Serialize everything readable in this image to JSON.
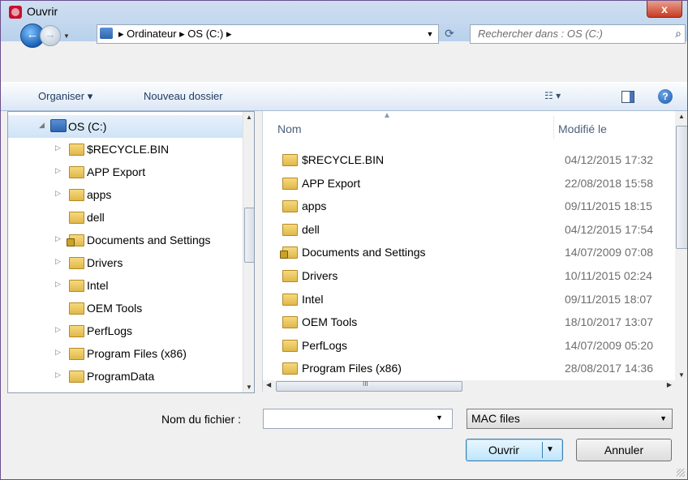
{
  "window": {
    "title": "Ouvrir",
    "close": "x"
  },
  "nav": {
    "back": "←",
    "forward": "→",
    "dropdown": "▼",
    "breadcrumb": "▸ Ordinateur ▸ OS (C:) ▸",
    "address_dropdown": "▼",
    "refresh": "⟳",
    "search_placeholder": "Rechercher dans : OS (C:)",
    "search_icon": "⌕"
  },
  "toolbar": {
    "organise": "Organiser ▾",
    "new_folder": "Nouveau dossier",
    "view_menu": "☷ ▾",
    "help": "?"
  },
  "tree": {
    "root": "OS (C:)",
    "items": [
      {
        "label": "$RECYCLE.BIN",
        "arrow": "▷"
      },
      {
        "label": "APP Export",
        "arrow": "▷"
      },
      {
        "label": "apps",
        "arrow": "▷"
      },
      {
        "label": "dell",
        "arrow": ""
      },
      {
        "label": "Documents and Settings",
        "arrow": "▷"
      },
      {
        "label": "Drivers",
        "arrow": "▷"
      },
      {
        "label": "Intel",
        "arrow": "▷"
      },
      {
        "label": "OEM Tools",
        "arrow": ""
      },
      {
        "label": "PerfLogs",
        "arrow": "▷"
      },
      {
        "label": "Program Files (x86)",
        "arrow": "▷"
      },
      {
        "label": "ProgramData",
        "arrow": "▷"
      }
    ],
    "root_arrow": "◢"
  },
  "files": {
    "col_name": "Nom",
    "col_modified": "Modifié le",
    "rows": [
      {
        "name": "$RECYCLE.BIN",
        "date": "04/12/2015 17:32"
      },
      {
        "name": "APP Export",
        "date": "22/08/2018 15:58"
      },
      {
        "name": "apps",
        "date": "09/11/2015 18:15"
      },
      {
        "name": "dell",
        "date": "04/12/2015 17:54"
      },
      {
        "name": "Documents and Settings",
        "date": "14/07/2009 07:08"
      },
      {
        "name": "Drivers",
        "date": "10/11/2015 02:24"
      },
      {
        "name": "Intel",
        "date": "09/11/2015 18:07"
      },
      {
        "name": "OEM Tools",
        "date": "18/10/2017 13:07"
      },
      {
        "name": "PerfLogs",
        "date": "14/07/2009 05:20"
      },
      {
        "name": "Program Files (x86)",
        "date": "28/08/2017 14:36"
      }
    ]
  },
  "footer": {
    "filename_label": "Nom du fichier :",
    "filename_value": "",
    "filename_dropdown": "▼",
    "filter_value": "MAC files",
    "filter_dropdown": "▼",
    "open": "Ouvrir",
    "open_dropdown": "▼",
    "cancel": "Annuler"
  }
}
